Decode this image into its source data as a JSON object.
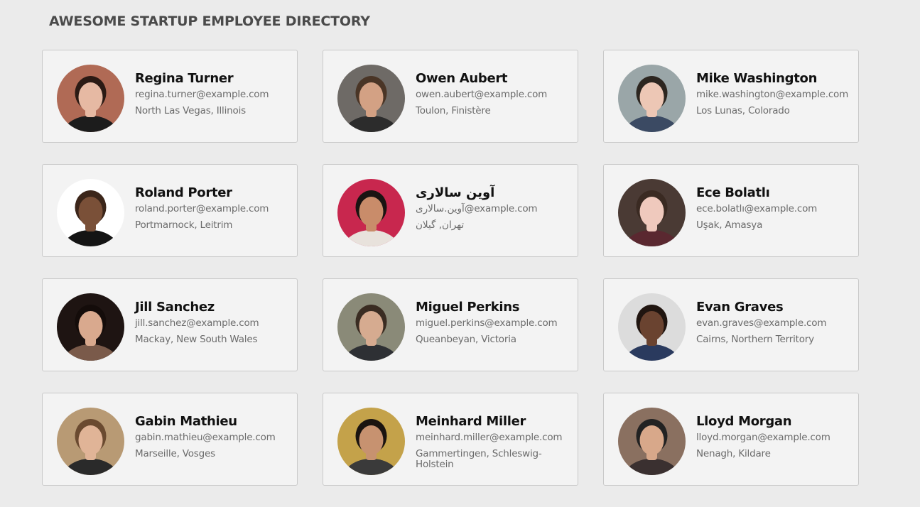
{
  "header": {
    "title": "AWESOME STARTUP EMPLOYEE DIRECTORY"
  },
  "employees": [
    {
      "name": "Regina Turner",
      "email": "regina.turner@example.com",
      "location": "North Las Vegas, Illinois",
      "avatar": {
        "bg": "#b06a55",
        "skin": "#e6b9a3",
        "hair": "#2b1a14",
        "shirt": "#1c1c1c",
        "fg": "#2b1a14"
      }
    },
    {
      "name": "Owen Aubert",
      "email": "owen.aubert@example.com",
      "location": "Toulon, Finistère",
      "avatar": {
        "bg": "#6e6a66",
        "skin": "#d3a184",
        "hair": "#4a3526",
        "shirt": "#2c2c2c",
        "fg": "#4a3526"
      }
    },
    {
      "name": "Mike Washington",
      "email": "mike.washington@example.com",
      "location": "Los Lunas, Colorado",
      "avatar": {
        "bg": "#9aa6a8",
        "skin": "#edc7b5",
        "hair": "#2d2620",
        "shirt": "#3b4a63",
        "fg": "#2d2620"
      }
    },
    {
      "name": "Roland Porter",
      "email": "roland.porter@example.com",
      "location": "Portmarnock, Leitrim",
      "avatar": {
        "bg": "#ffffff",
        "skin": "#7a5038",
        "hair": "#3c261a",
        "shirt": "#141414",
        "fg": "#3c261a"
      }
    },
    {
      "name": "آوین سالاری",
      "email": "آوین.سالاری@example.com",
      "location": "تهران, گیلان",
      "avatar": {
        "bg": "#c8274e",
        "skin": "#c98c6a",
        "hair": "#1a1412",
        "shirt": "#e8e2dc",
        "fg": "#1a1412"
      }
    },
    {
      "name": "Ece Bolatlı",
      "email": "ece.bolatlı@example.com",
      "location": "Uşak, Amasya",
      "avatar": {
        "bg": "#4a3a34",
        "skin": "#efc9bd",
        "hair": "#3a2a22",
        "shirt": "#5a2830",
        "fg": "#3a2a22"
      }
    },
    {
      "name": "Jill Sanchez",
      "email": "jill.sanchez@example.com",
      "location": "Mackay, New South Wales",
      "avatar": {
        "bg": "#1e1412",
        "skin": "#d9a98e",
        "hair": "#140c0a",
        "shirt": "#7a5a4a",
        "fg": "#140c0a"
      }
    },
    {
      "name": "Miguel Perkins",
      "email": "miguel.perkins@example.com",
      "location": "Queanbeyan, Victoria",
      "avatar": {
        "bg": "#8a8a78",
        "skin": "#d6ab90",
        "hair": "#3a2c22",
        "shirt": "#2e3034",
        "fg": "#3a2c22"
      }
    },
    {
      "name": "Evan Graves",
      "email": "evan.graves@example.com",
      "location": "Cairns, Northern Territory",
      "avatar": {
        "bg": "#dcdcdc",
        "skin": "#6a4330",
        "hair": "#201510",
        "shirt": "#2a3a5e",
        "fg": "#201510"
      }
    },
    {
      "name": "Gabin Mathieu",
      "email": "gabin.mathieu@example.com",
      "location": "Marseille, Vosges",
      "avatar": {
        "bg": "#b89a74",
        "skin": "#e0b497",
        "hair": "#6a4a30",
        "shirt": "#2a2a2a",
        "fg": "#6a4a30"
      }
    },
    {
      "name": "Meinhard Miller",
      "email": "meinhard.miller@example.com",
      "location": "Gammertingen, Schleswig-Holstein",
      "avatar": {
        "bg": "#c4a24a",
        "skin": "#c79270",
        "hair": "#1a1410",
        "shirt": "#3a3a3a",
        "fg": "#1a1410"
      }
    },
    {
      "name": "Lloyd Morgan",
      "email": "lloyd.morgan@example.com",
      "location": "Nenagh, Kildare",
      "avatar": {
        "bg": "#8a7060",
        "skin": "#d8a88a",
        "hair": "#222222",
        "shirt": "#3a3030",
        "fg": "#222222"
      }
    }
  ]
}
